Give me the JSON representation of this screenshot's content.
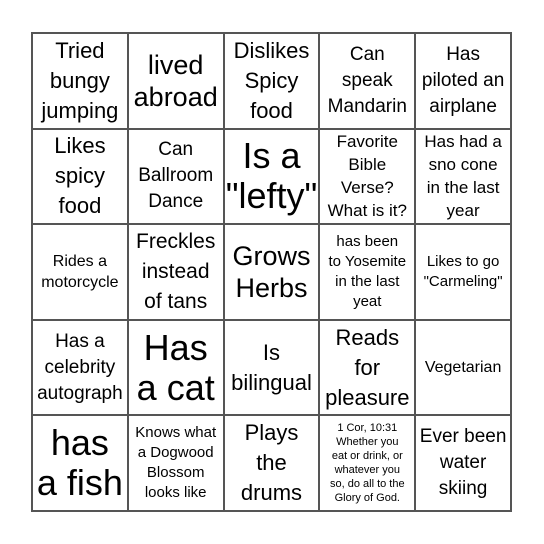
{
  "board": {
    "cells": [
      {
        "text": "Tried\nbungy\njumping",
        "size": "s-m"
      },
      {
        "text": "lived\nabroad",
        "size": "s-l"
      },
      {
        "text": "Dislikes\nSpicy\nfood",
        "size": "s-m"
      },
      {
        "text": "Can\nspeak\nMandarin",
        "size": "s-sm"
      },
      {
        "text": "Has\npiloted an\nairplane",
        "size": "s-sm"
      },
      {
        "text": "Likes\nspicy\nfood",
        "size": "s-m"
      },
      {
        "text": "Can\nBallroom\nDance",
        "size": "s-sm"
      },
      {
        "text": "Is a\n\"lefty\"",
        "size": "s-xl"
      },
      {
        "text": "Favorite\nBible\nVerse?\nWhat is it?",
        "size": "s-s"
      },
      {
        "text": "Has had a\nsno cone\nin the last\nyear",
        "size": "s-s"
      },
      {
        "text": "Rides a\nmotorcycle",
        "size": "s-xs"
      },
      {
        "text": "Freckles\ninstead\nof tans",
        "size": "s-ms"
      },
      {
        "text": "Grows\nHerbs",
        "size": "s-l"
      },
      {
        "text": "has been\nto Yosemite\nin the last\nyeat",
        "size": "s-vs"
      },
      {
        "text": "Likes to go\n\"Carmeling\"",
        "size": "s-vs"
      },
      {
        "text": "Has a\ncelebrity\nautograph",
        "size": "s-sm"
      },
      {
        "text": "Has\na cat",
        "size": "s-xl"
      },
      {
        "text": "Is\nbilingual",
        "size": "s-m"
      },
      {
        "text": "Reads\nfor\npleasure",
        "size": "s-m"
      },
      {
        "text": "Vegetarian",
        "size": "s-xs"
      },
      {
        "text": "has\na fish",
        "size": "s-xl"
      },
      {
        "text": "Knows what\na Dogwood\nBlossom\nlooks like",
        "size": "s-vs"
      },
      {
        "text": "Plays\nthe\ndrums",
        "size": "s-m"
      },
      {
        "text": "1 Cor, 10:31\nWhether you\neat or drink, or\nwhatever you\nso, do all to the\nGlory of God.",
        "size": "s-t"
      },
      {
        "text": "Ever been\nwater\nskiing",
        "size": "s-sm"
      }
    ]
  }
}
